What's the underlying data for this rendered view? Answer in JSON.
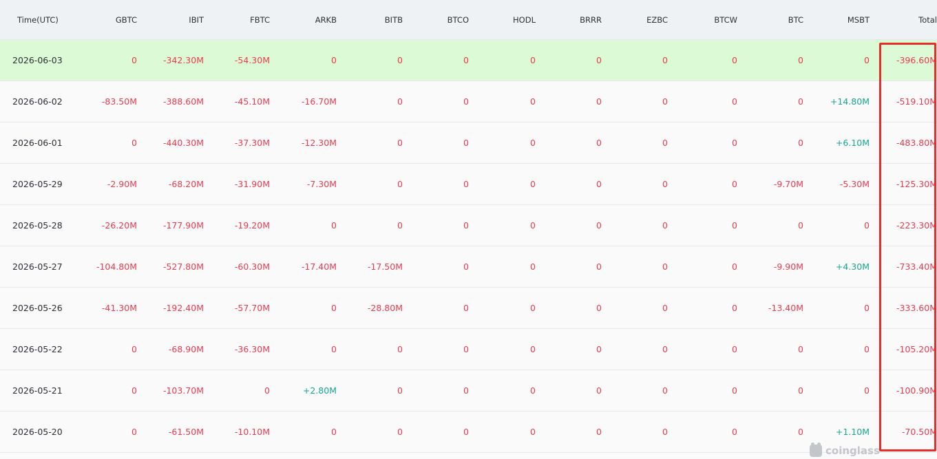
{
  "columns": [
    "Time(UTC)",
    "GBTC",
    "IBIT",
    "FBTC",
    "ARKB",
    "BITB",
    "BTCO",
    "HODL",
    "BRRR",
    "EZBC",
    "BTCW",
    "BTC",
    "MSBT",
    "Total"
  ],
  "rows": [
    {
      "highlighted": true,
      "cells": [
        "2026-06-03",
        "0",
        "-342.30M",
        "-54.30M",
        "0",
        "0",
        "0",
        "0",
        "0",
        "0",
        "0",
        "0",
        "0",
        "-396.60M"
      ]
    },
    {
      "highlighted": false,
      "cells": [
        "2026-06-02",
        "-83.50M",
        "-388.60M",
        "-45.10M",
        "-16.70M",
        "0",
        "0",
        "0",
        "0",
        "0",
        "0",
        "0",
        "+14.80M",
        "-519.10M"
      ]
    },
    {
      "highlighted": false,
      "cells": [
        "2026-06-01",
        "0",
        "-440.30M",
        "-37.30M",
        "-12.30M",
        "0",
        "0",
        "0",
        "0",
        "0",
        "0",
        "0",
        "+6.10M",
        "-483.80M"
      ]
    },
    {
      "highlighted": false,
      "cells": [
        "2026-05-29",
        "-2.90M",
        "-68.20M",
        "-31.90M",
        "-7.30M",
        "0",
        "0",
        "0",
        "0",
        "0",
        "0",
        "-9.70M",
        "-5.30M",
        "-125.30M"
      ]
    },
    {
      "highlighted": false,
      "cells": [
        "2026-05-28",
        "-26.20M",
        "-177.90M",
        "-19.20M",
        "0",
        "0",
        "0",
        "0",
        "0",
        "0",
        "0",
        "0",
        "0",
        "-223.30M"
      ]
    },
    {
      "highlighted": false,
      "cells": [
        "2026-05-27",
        "-104.80M",
        "-527.80M",
        "-60.30M",
        "-17.40M",
        "-17.50M",
        "0",
        "0",
        "0",
        "0",
        "0",
        "-9.90M",
        "+4.30M",
        "-733.40M"
      ]
    },
    {
      "highlighted": false,
      "cells": [
        "2026-05-26",
        "-41.30M",
        "-192.40M",
        "-57.70M",
        "0",
        "-28.80M",
        "0",
        "0",
        "0",
        "0",
        "0",
        "-13.40M",
        "0",
        "-333.60M"
      ]
    },
    {
      "highlighted": false,
      "cells": [
        "2026-05-22",
        "0",
        "-68.90M",
        "-36.30M",
        "0",
        "0",
        "0",
        "0",
        "0",
        "0",
        "0",
        "0",
        "0",
        "-105.20M"
      ]
    },
    {
      "highlighted": false,
      "cells": [
        "2026-05-21",
        "0",
        "-103.70M",
        "0",
        "+2.80M",
        "0",
        "0",
        "0",
        "0",
        "0",
        "0",
        "0",
        "0",
        "-100.90M"
      ]
    },
    {
      "highlighted": false,
      "cells": [
        "2026-05-20",
        "0",
        "-61.50M",
        "-10.10M",
        "0",
        "0",
        "0",
        "0",
        "0",
        "0",
        "0",
        "0",
        "+1.10M",
        "-70.50M"
      ]
    }
  ],
  "watermark": {
    "text": "coinglass",
    "icon": "coinglass-logo-icon"
  },
  "colors": {
    "negative": "#ec3b4f",
    "positive": "#16a890",
    "highlight_row": "#dbfad5",
    "header_bg": "#eff2f5",
    "total_box": "#e82b2b"
  }
}
